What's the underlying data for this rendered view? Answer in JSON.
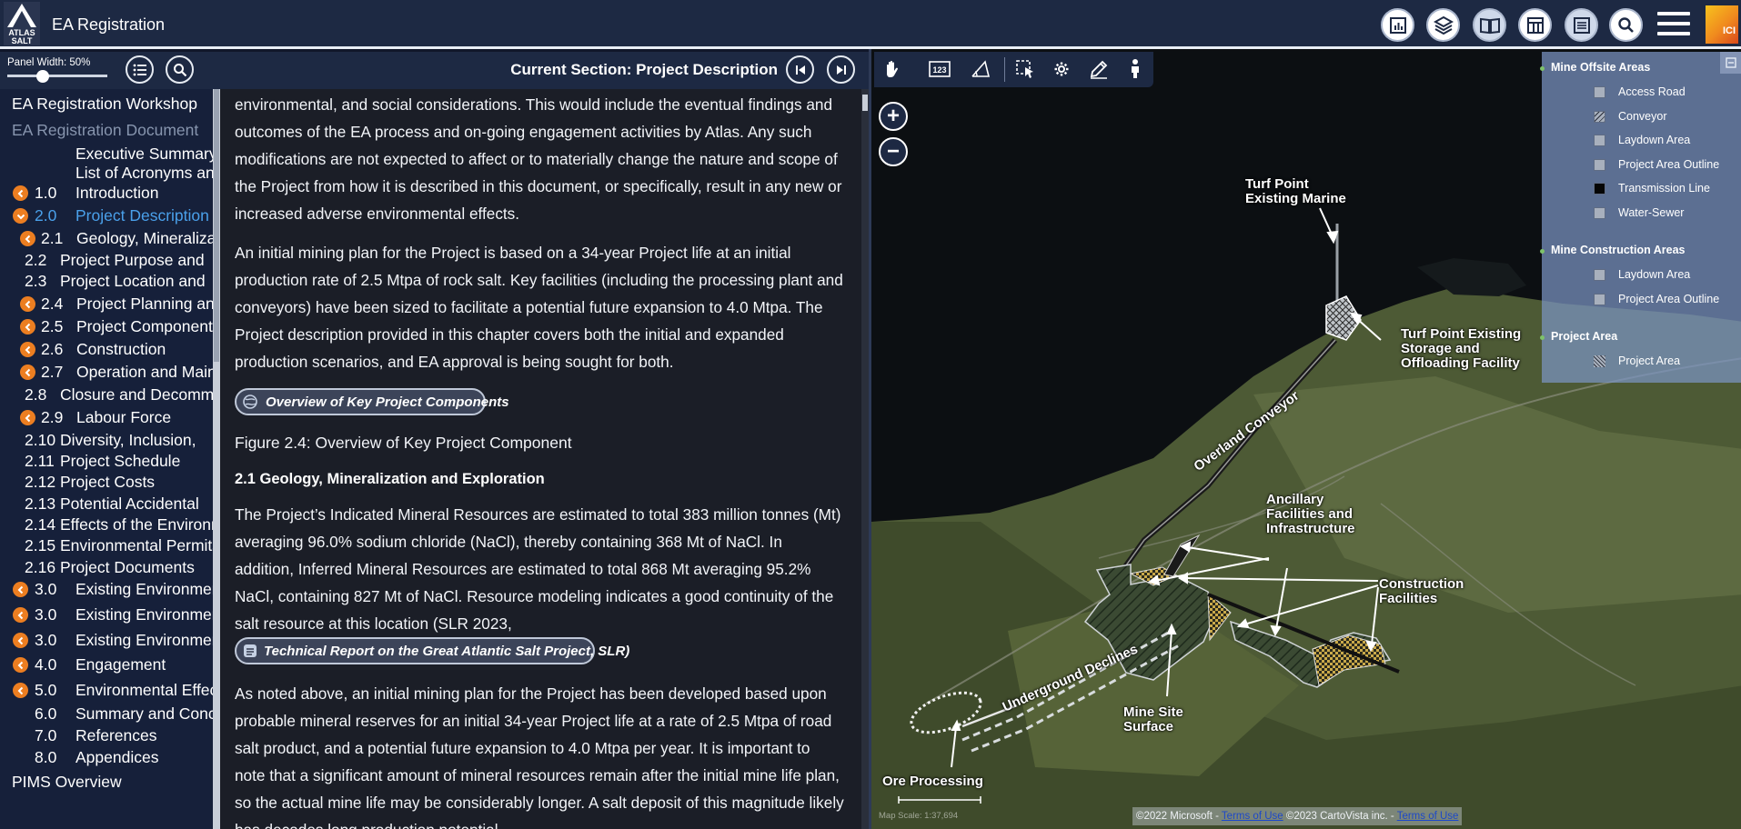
{
  "header": {
    "title": "EA Registration",
    "logo_text_1": "ATLAS",
    "logo_text_2": "SALT",
    "ici_text": "ICI"
  },
  "toc": {
    "panel_width_label": "Panel Width: 50%",
    "panel_width_value": 50,
    "items": [
      {
        "num": "",
        "label": "EA Registration Workshop",
        "indent": 0,
        "state": "normal",
        "chevron": "none"
      },
      {
        "num": "",
        "label": "EA Registration Document",
        "indent": 0,
        "state": "muted",
        "chevron": "none"
      },
      {
        "num": "",
        "label": "Executive Summary",
        "indent": 2,
        "state": "normal",
        "chevron": "none"
      },
      {
        "num": "",
        "label": "List of Acronyms and",
        "indent": 2,
        "state": "normal",
        "chevron": "none"
      },
      {
        "num": "1.0",
        "label": "Introduction",
        "indent": 1,
        "state": "normal",
        "chevron": "collapsed"
      },
      {
        "num": "2.0",
        "label": "Project Description",
        "indent": 1,
        "state": "current",
        "chevron": "expanded"
      },
      {
        "num": "2.1",
        "label": "Geology, Mineralization",
        "indent": 3,
        "state": "normal",
        "chevron": "collapsed"
      },
      {
        "num": "2.2",
        "label": "Project Purpose and",
        "indent": 4,
        "state": "normal",
        "chevron": "none"
      },
      {
        "num": "2.3",
        "label": "Project Location and",
        "indent": 4,
        "state": "normal",
        "chevron": "none"
      },
      {
        "num": "2.4",
        "label": "Project Planning and",
        "indent": 3,
        "state": "normal",
        "chevron": "collapsed"
      },
      {
        "num": "2.5",
        "label": "Project Components",
        "indent": 3,
        "state": "normal",
        "chevron": "collapsed"
      },
      {
        "num": "2.6",
        "label": "Construction",
        "indent": 3,
        "state": "normal",
        "chevron": "collapsed"
      },
      {
        "num": "2.7",
        "label": "Operation and Maintenance",
        "indent": 3,
        "state": "normal",
        "chevron": "collapsed"
      },
      {
        "num": "2.8",
        "label": "Closure and Decommissioning",
        "indent": 4,
        "state": "normal",
        "chevron": "none"
      },
      {
        "num": "2.9",
        "label": "Labour Force",
        "indent": 3,
        "state": "normal",
        "chevron": "collapsed"
      },
      {
        "num": "2.10",
        "label": "Diversity, Inclusion,",
        "indent": 4,
        "state": "normal",
        "chevron": "none"
      },
      {
        "num": "2.11",
        "label": "Project Schedule",
        "indent": 4,
        "state": "normal",
        "chevron": "none"
      },
      {
        "num": "2.12",
        "label": "Project Costs",
        "indent": 4,
        "state": "normal",
        "chevron": "none"
      },
      {
        "num": "2.13",
        "label": "Potential Accidental",
        "indent": 4,
        "state": "normal",
        "chevron": "none"
      },
      {
        "num": "2.14",
        "label": "Effects of the Environment",
        "indent": 4,
        "state": "normal",
        "chevron": "none"
      },
      {
        "num": "2.15",
        "label": "Environmental Permits",
        "indent": 4,
        "state": "normal",
        "chevron": "none"
      },
      {
        "num": "2.16",
        "label": "Project Documents",
        "indent": 4,
        "state": "normal",
        "chevron": "none"
      },
      {
        "num": "3.0",
        "label": "Existing Environment",
        "indent": 1,
        "state": "normal",
        "chevron": "collapsed"
      },
      {
        "num": "3.0",
        "label": "Existing Environment",
        "indent": 1,
        "state": "normal",
        "chevron": "collapsed"
      },
      {
        "num": "3.0",
        "label": "Existing Environment",
        "indent": 1,
        "state": "normal",
        "chevron": "collapsed"
      },
      {
        "num": "4.0",
        "label": "Engagement",
        "indent": 1,
        "state": "normal",
        "chevron": "collapsed"
      },
      {
        "num": "5.0",
        "label": "Environmental Effects",
        "indent": 1,
        "state": "normal",
        "chevron": "collapsed"
      },
      {
        "num": "6.0",
        "label": "Summary and Conclusions",
        "indent": 1,
        "state": "normal",
        "chevron": "none"
      },
      {
        "num": "7.0",
        "label": "References",
        "indent": 1,
        "state": "normal",
        "chevron": "none"
      },
      {
        "num": "8.0",
        "label": "Appendices",
        "indent": 1,
        "state": "normal",
        "chevron": "none"
      },
      {
        "num": "",
        "label": "PIMS Overview",
        "indent": 0,
        "state": "normal",
        "chevron": "none"
      }
    ]
  },
  "document": {
    "current_section": "Current Section: Project Description",
    "para1": "environmental, and social considerations. This would include the eventual findings and outcomes of the EA process and on-going engagement activities by Atlas. Any such modifications are not expected to affect or to materially change the nature and scope of the Project from how it is described in this document, or specifically, result in any new or increased adverse environmental effects.",
    "para2": "An initial mining plan for the Project is based on a 34-year Project life at an initial production rate of 2.5 Mtpa of rock salt. Key facilities (including the processing plant and conveyors) have been sized to facilitate a potential future expansion to 4.0 Mtpa.  The Project description provided in this chapter covers both the initial and expanded production scenarios, and EA approval is being sought for both.",
    "pill1": "Overview of Key Project Components",
    "figure_caption": "Figure 2.4: Overview of Key Project Component",
    "subheading": "2.1 Geology, Mineralization and Exploration",
    "para3": "The Project’s Indicated Mineral Resources are estimated to total 383 million tonnes (Mt) averaging 96.0% sodium chloride (NaCl), thereby containing 368 Mt of NaCl. In addition, Inferred Mineral Resources are estimated to total 868 Mt averaging 95.2% NaCl, containing 827 Mt of NaCl. Resource modeling indicates a good continuity of the salt resource at this location (SLR 2023,",
    "pill2": "Technical Report on the Great Atlantic Salt Project, SLR)",
    "para4": "As noted above, an initial mining plan for the Project has been developed based upon probable mineral reserves for an initial 34-year Project life at a rate of 2.5 Mtpa of road salt product, and a potential future expansion to 4.0 Mtpa per year. It is important to note that a significant amount of mineral resources remain after the initial mine life plan, so the actual mine life may be considerably longer. A salt deposit of this magnitude likely has decades long production potential."
  },
  "map": {
    "labels": {
      "turf_marine": "Turf Point\nExisting Marine",
      "turf_storage": "Turf Point Existing\nStorage and\nOffloading Facility",
      "overland_conveyor": "Overland Conveyor",
      "ancillary": "Ancillary\nFacilities and\nInfrastructure",
      "construction": "Construction\nFacilities",
      "underground": "Underground Declines",
      "mine_site": "Mine Site\nSurface",
      "ore_processing": "Ore Processing"
    },
    "legend": {
      "groups": [
        {
          "title": "Mine Offsite Areas",
          "items": [
            "Access Road",
            "Conveyor",
            "Laydown Area",
            "Project Area Outline",
            "Transmission Line",
            "Water-Sewer"
          ]
        },
        {
          "title": "Mine Construction Areas",
          "items": [
            "Laydown Area",
            "Project Area Outline"
          ]
        },
        {
          "title": "Project Area",
          "items": [
            "Project Area"
          ]
        }
      ]
    },
    "attribution": {
      "ms": "©2022 Microsoft - ",
      "terms1": "Terms of Use",
      "cv": " ©2023 CartoVista inc. - ",
      "terms2": "Terms of Use"
    },
    "scale_text": "Map Scale: 1:37,694"
  },
  "colors": {
    "header_bg": "#1d2943",
    "accent_orange": "#ec7e21",
    "current_blue": "#4aa0ea"
  }
}
